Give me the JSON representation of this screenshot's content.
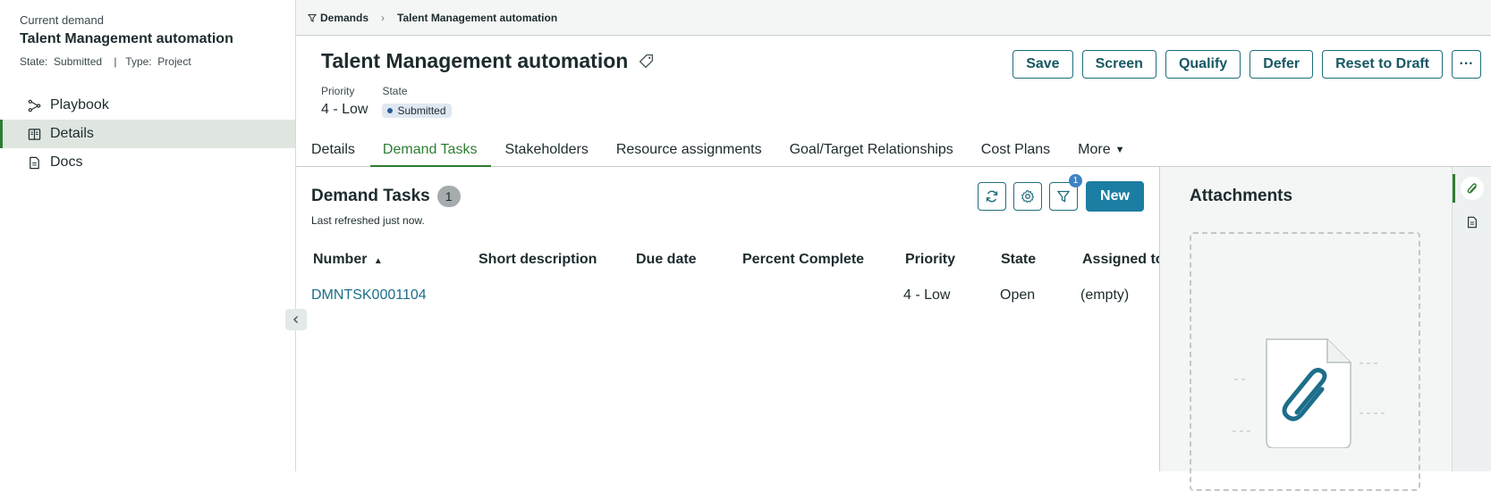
{
  "sidebar": {
    "current_label": "Current demand",
    "title": "Talent Management automation",
    "meta": "State:  Submitted    |   Type:  Project",
    "items": [
      {
        "label": "Playbook",
        "icon": "playbook-icon"
      },
      {
        "label": "Details",
        "icon": "details-icon"
      },
      {
        "label": "Docs",
        "icon": "docs-icon"
      }
    ]
  },
  "breadcrumb": {
    "root": "Demands",
    "current": "Talent Management automation"
  },
  "header": {
    "title": "Talent Management automation",
    "priority_label": "Priority",
    "priority_value": "4 - Low",
    "state_label": "State",
    "state_value": "Submitted"
  },
  "actions": {
    "save": "Save",
    "screen": "Screen",
    "qualify": "Qualify",
    "defer": "Defer",
    "reset": "Reset to Draft",
    "more": "···"
  },
  "tabs": [
    "Details",
    "Demand Tasks",
    "Stakeholders",
    "Resource assignments",
    "Goal/Target Relationships",
    "Cost Plans",
    "More"
  ],
  "list": {
    "title": "Demand Tasks",
    "count": "1",
    "refreshed": "Last refreshed just now.",
    "filter_count": "1",
    "new_label": "New",
    "columns": [
      "Number",
      "Short description",
      "Due date",
      "Percent Complete",
      "Priority",
      "State",
      "Assigned to"
    ],
    "rows": [
      {
        "number": "DMNTSK0001104",
        "short_description": "",
        "due_date": "",
        "percent_complete": "",
        "priority": "4 - Low",
        "state": "Open",
        "assigned_to": "(empty)"
      }
    ]
  },
  "attachments": {
    "title": "Attachments"
  },
  "colors": {
    "accent": "#1f6e7a",
    "active_green": "#2e7d32",
    "new_button": "#1c7da3"
  }
}
